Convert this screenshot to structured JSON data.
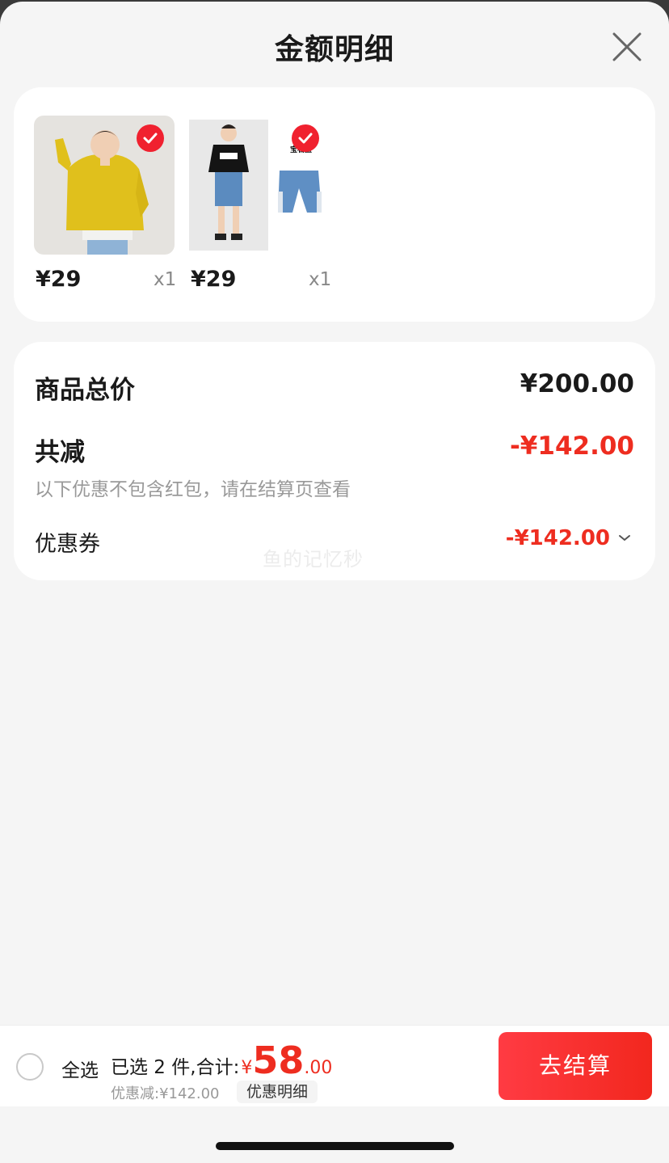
{
  "header": {
    "title": "金额明细"
  },
  "products": [
    {
      "price": "¥29",
      "qty": "x1",
      "selected": true,
      "image": "model in yellow hoodie"
    },
    {
      "price": "¥29",
      "qty": "x1",
      "selected": true,
      "image": "model in black tee and denim shorts",
      "brand_text": "宝石蓝"
    }
  ],
  "summary": {
    "total_label": "商品总价",
    "total_value": "¥200.00",
    "reduce_label": "共减",
    "reduce_value": "-¥142.00",
    "reduce_note": "以下优惠不包含红包，请在结算页查看",
    "coupon_label": "优惠券",
    "coupon_value": "-¥142.00"
  },
  "watermark": "鱼的记忆秒",
  "bottom_bar": {
    "select_all_label": "全选",
    "selected_text": "已选 2 件,合计:",
    "currency": "¥",
    "amount_int": "58",
    "amount_dec": ".00",
    "discount_text": "优惠减:¥142.00",
    "detail_button": "优惠明细",
    "checkout_button": "去结算"
  },
  "colors": {
    "accent": "#ee2d20",
    "button_start": "#ff3b43",
    "button_end": "#f2271e"
  }
}
